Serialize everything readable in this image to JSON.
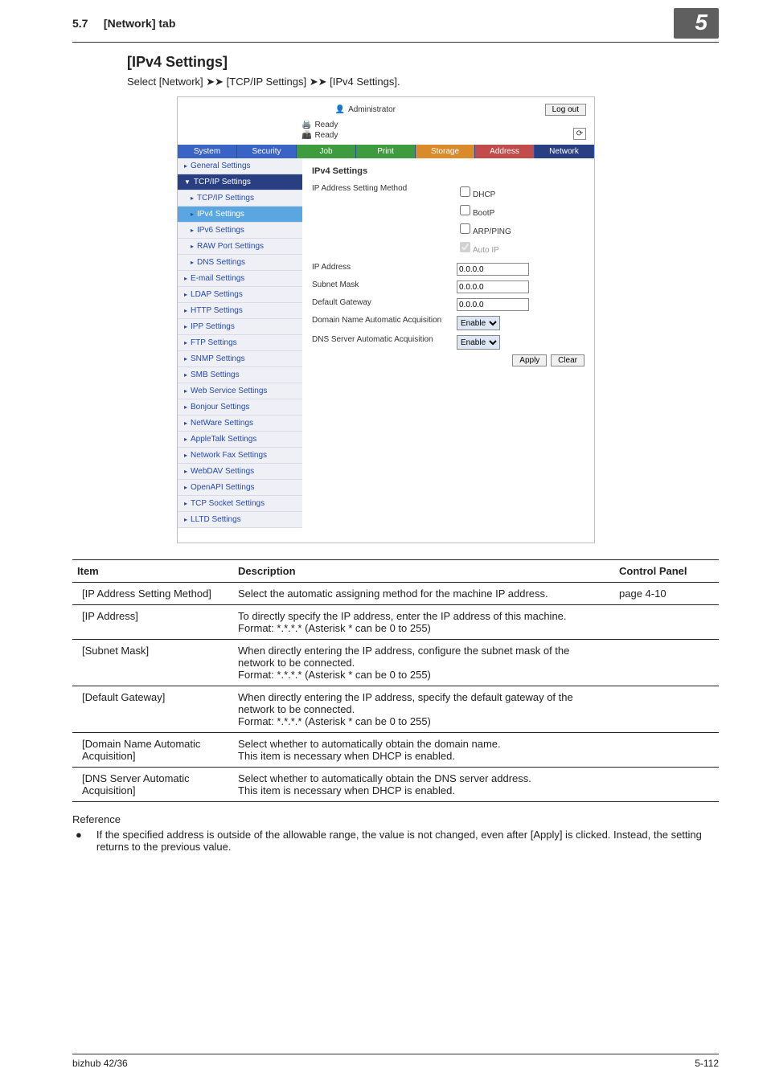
{
  "header": {
    "section": "5.7",
    "tab": "[Network] tab",
    "chapter": "5"
  },
  "title": "[IPv4 Settings]",
  "breadcrumb": "Select [Network] ➤➤ [TCP/IP Settings] ➤➤ [IPv4 Settings].",
  "shot": {
    "admin": "Administrator",
    "logout": "Log out",
    "ready1": "Ready",
    "ready2": "Ready",
    "tabs": [
      "System",
      "Security",
      "Job",
      "Print",
      "Storage",
      "Address",
      "Network"
    ],
    "sidebar": [
      {
        "label": "General Settings",
        "type": "item"
      },
      {
        "label": "TCP/IP Settings",
        "type": "group"
      },
      {
        "label": "TCP/IP Settings",
        "type": "child"
      },
      {
        "label": "IPv4 Settings",
        "type": "child active"
      },
      {
        "label": "IPv6 Settings",
        "type": "child"
      },
      {
        "label": "RAW Port Settings",
        "type": "child"
      },
      {
        "label": "DNS Settings",
        "type": "child"
      },
      {
        "label": "E-mail Settings",
        "type": "item"
      },
      {
        "label": "LDAP Settings",
        "type": "item"
      },
      {
        "label": "HTTP Settings",
        "type": "item"
      },
      {
        "label": "IPP Settings",
        "type": "item"
      },
      {
        "label": "FTP Settings",
        "type": "item"
      },
      {
        "label": "SNMP Settings",
        "type": "item"
      },
      {
        "label": "SMB Settings",
        "type": "item"
      },
      {
        "label": "Web Service Settings",
        "type": "item"
      },
      {
        "label": "Bonjour Settings",
        "type": "item"
      },
      {
        "label": "NetWare Settings",
        "type": "item"
      },
      {
        "label": "AppleTalk Settings",
        "type": "item"
      },
      {
        "label": "Network Fax Settings",
        "type": "item"
      },
      {
        "label": "WebDAV Settings",
        "type": "item"
      },
      {
        "label": "OpenAPI Settings",
        "type": "item"
      },
      {
        "label": "TCP Socket Settings",
        "type": "item"
      },
      {
        "label": "LLTD Settings",
        "type": "item"
      }
    ],
    "panel": {
      "title": "IPv4 Settings",
      "rows": {
        "method_label": "IP Address Setting Method",
        "dhcp": "DHCP",
        "bootp": "BootP",
        "arpping": "ARP/PING",
        "autoip": "Auto IP",
        "ip_label": "IP Address",
        "ip_value": "0.0.0.0",
        "subnet_label": "Subnet Mask",
        "subnet_value": "0.0.0.0",
        "gateway_label": "Default Gateway",
        "gateway_value": "0.0.0.0",
        "domain_label": "Domain Name Automatic Acquisition",
        "domain_value": "Enable",
        "dns_label": "DNS Server Automatic Acquisition",
        "dns_value": "Enable"
      },
      "apply": "Apply",
      "clear": "Clear"
    }
  },
  "table": {
    "headers": [
      "Item",
      "Description",
      "Control Panel"
    ],
    "rows": [
      {
        "item": "[IP Address Setting Method]",
        "desc": "Select the automatic assigning method for the machine IP address.",
        "cp": "page 4-10"
      },
      {
        "item": "[IP Address]",
        "desc": "To directly specify the IP address, enter the IP address of this machine.\nFormat: *.*.*.* (Asterisk * can be 0 to 255)",
        "cp": ""
      },
      {
        "item": "[Subnet Mask]",
        "desc": "When directly entering the IP address, configure the subnet mask of the network to be connected.\nFormat: *.*.*.* (Asterisk * can be 0 to 255)",
        "cp": ""
      },
      {
        "item": "[Default Gateway]",
        "desc": "When directly entering the IP address, specify the default gateway of the network to be connected.\nFormat: *.*.*.* (Asterisk * can be 0 to 255)",
        "cp": ""
      },
      {
        "item": "[Domain Name Automatic Acquisition]",
        "desc": "Select whether to automatically obtain the domain name.\nThis item is necessary when DHCP is enabled.",
        "cp": ""
      },
      {
        "item": "[DNS Server Automatic Acquisition]",
        "desc": "Select whether to automatically obtain the DNS server address.\nThis item is necessary when DHCP is enabled.",
        "cp": ""
      }
    ]
  },
  "reference": {
    "label": "Reference",
    "item": "If the specified address is outside of the allowable range, the value is not changed, even after [Apply] is clicked. Instead, the setting returns to the previous value."
  },
  "footer": {
    "left": "bizhub 42/36",
    "right": "5-112"
  }
}
